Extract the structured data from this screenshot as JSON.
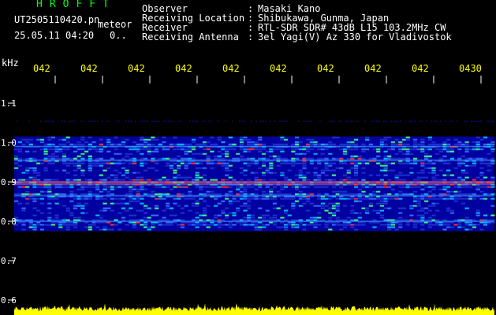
{
  "header": {
    "brand": "HROFFT",
    "filename": "UT2505110420.pn",
    "mode": "meteor",
    "timestamp": "25.05.11 04:20",
    "counter": "0..",
    "fields": [
      {
        "label": "Observer",
        "value": "Masaki Kano"
      },
      {
        "label": "Receiving Location",
        "value": "Shibukawa, Gunma, Japan"
      },
      {
        "label": "Receiver",
        "value": "RTL-SDR SDR# 43dB L15 103.2MHz CW"
      },
      {
        "label": "Receiving Antenna",
        "value": "3el Yagi(V) Az 330 for Vladivostok"
      }
    ]
  },
  "colors": {
    "background": "#000000",
    "text_white": "#ffffff",
    "text_yellow": "#ffff00",
    "brand_green": "#00ff00",
    "spectrum_low": "#0000a0",
    "spectrum_mid": "#00c0ff",
    "spectrum_high": "#ff3030",
    "power_trace": "#ffff00"
  },
  "chart_data": {
    "type": "heatmap",
    "yunit": "kHz",
    "x_ticks": [
      "042",
      "042",
      "042",
      "042",
      "042",
      "042",
      "042",
      "042",
      "042",
      "0430"
    ],
    "y_ticks": [
      "1.1",
      "1.0",
      "0.9",
      "0.8",
      "0.7",
      "0.6"
    ],
    "ylim": [
      0.6,
      1.1
    ],
    "signal_band": [
      0.775,
      1.015
    ],
    "strong_lines": [
      0.8,
      0.865,
      0.895,
      0.9,
      0.955,
      0.99
    ],
    "power_trace_level": 0.04
  }
}
